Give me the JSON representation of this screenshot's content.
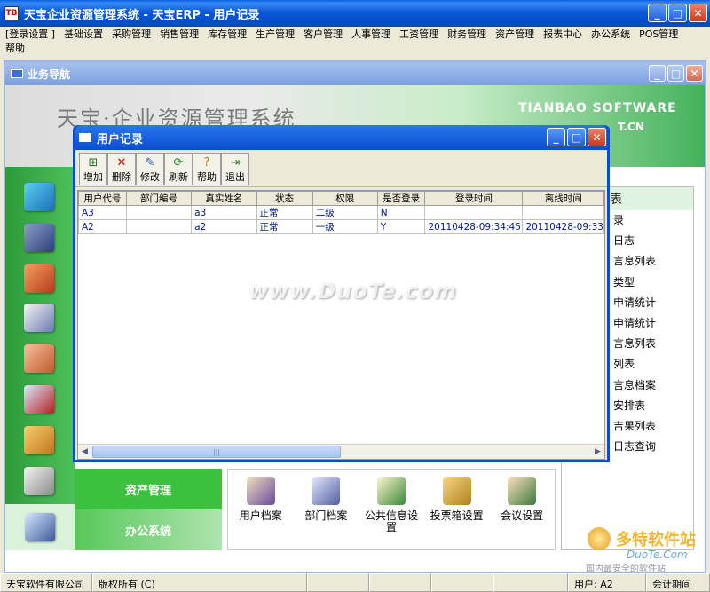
{
  "window": {
    "title": "天宝企业资源管理系统 - 天宝ERP - 用户记录",
    "icon_text": "TB"
  },
  "menu": [
    "[登录设置 ]",
    "基础设置",
    "采购管理",
    "销售管理",
    "库存管理",
    "生产管理",
    "客户管理",
    "人事管理",
    "工资管理",
    "财务管理",
    "资产管理",
    "报表中心",
    "办公系统",
    "POS管理",
    "帮助"
  ],
  "biz_window": {
    "title": "业务导航"
  },
  "banner": {
    "company": "天宝·企业资源管理系统",
    "brand_en": "TIANBAO SOFTWARE",
    "url_fragment": "T.CN"
  },
  "categories": [
    "资产管理",
    "办公系统"
  ],
  "functions": [
    {
      "label": "用户档案",
      "icon": "user-file-icon"
    },
    {
      "label": "部门档案",
      "icon": "department-file-icon"
    },
    {
      "label": "公共信息设 置",
      "icon": "public-info-icon"
    },
    {
      "label": "投票箱设置",
      "icon": "ballot-box-icon"
    },
    {
      "label": "会议设置",
      "icon": "meeting-icon"
    }
  ],
  "right_panel": {
    "header": "表",
    "items": [
      "录",
      "日志",
      "言息列表",
      "类型",
      "申请统计",
      "申请统计",
      "言息列表",
      "列表",
      "言息档案",
      "安排表",
      "吉果列表",
      "日志查询"
    ]
  },
  "dialog": {
    "title": "用户记录",
    "toolbar": [
      {
        "label": "增加",
        "icon": "add-icon"
      },
      {
        "label": "删除",
        "icon": "delete-icon"
      },
      {
        "label": "修改",
        "icon": "edit-icon"
      },
      {
        "label": "刷新",
        "icon": "refresh-icon"
      },
      {
        "label": "帮助",
        "icon": "help-icon"
      },
      {
        "label": "退出",
        "icon": "exit-icon"
      }
    ],
    "columns": [
      "用户代号",
      "部门编号",
      "真实姓名",
      "状态",
      "权限",
      "是否登录",
      "登录时间",
      "离线时间"
    ],
    "rows": [
      [
        "A3",
        "",
        "a3",
        "正常",
        "二级",
        "N",
        "",
        ""
      ],
      [
        "A2",
        "",
        "a2",
        "正常",
        "一级",
        "Y",
        "20110428-09:34:45",
        "20110428-09:33"
      ]
    ]
  },
  "watermark": {
    "center": "www.DuoTe.com",
    "brand": "多特软件站",
    "brand_url": "DuoTe.Com",
    "tagline": "国内最安全的软件站"
  },
  "status": {
    "company": "天宝软件有限公司",
    "copyright": "版权所有 (C)",
    "user_label": "用户: A2",
    "period": "会计期间"
  }
}
